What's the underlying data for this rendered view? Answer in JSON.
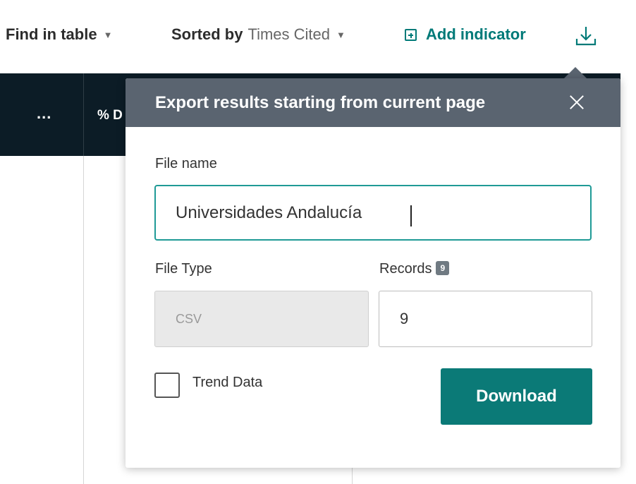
{
  "toolbar": {
    "find_label": "Find in table",
    "sorted_by_label": "Sorted by",
    "sorted_by_value": "Times Cited",
    "add_indicator_label": "Add indicator",
    "icons": [
      "chevron-down-icon",
      "plus-square-icon",
      "download-icon"
    ],
    "accent_color": "#007a78"
  },
  "table": {
    "header_columns": [
      "...",
      "% D"
    ],
    "header_bg": "#0c1c26"
  },
  "export_dialog": {
    "title": "Export results starting from current page",
    "close_icon": "close-icon",
    "file_name_label": "File name",
    "file_name_value": "Universidades Andalucía",
    "file_type_label": "File Type",
    "file_type_value": "CSV",
    "records_label": "Records",
    "records_badge": "9",
    "records_value": "9",
    "trend_data_label": "Trend Data",
    "trend_data_checked": false,
    "download_label": "Download",
    "header_color": "#5a6470",
    "button_color": "#0b7a77"
  }
}
